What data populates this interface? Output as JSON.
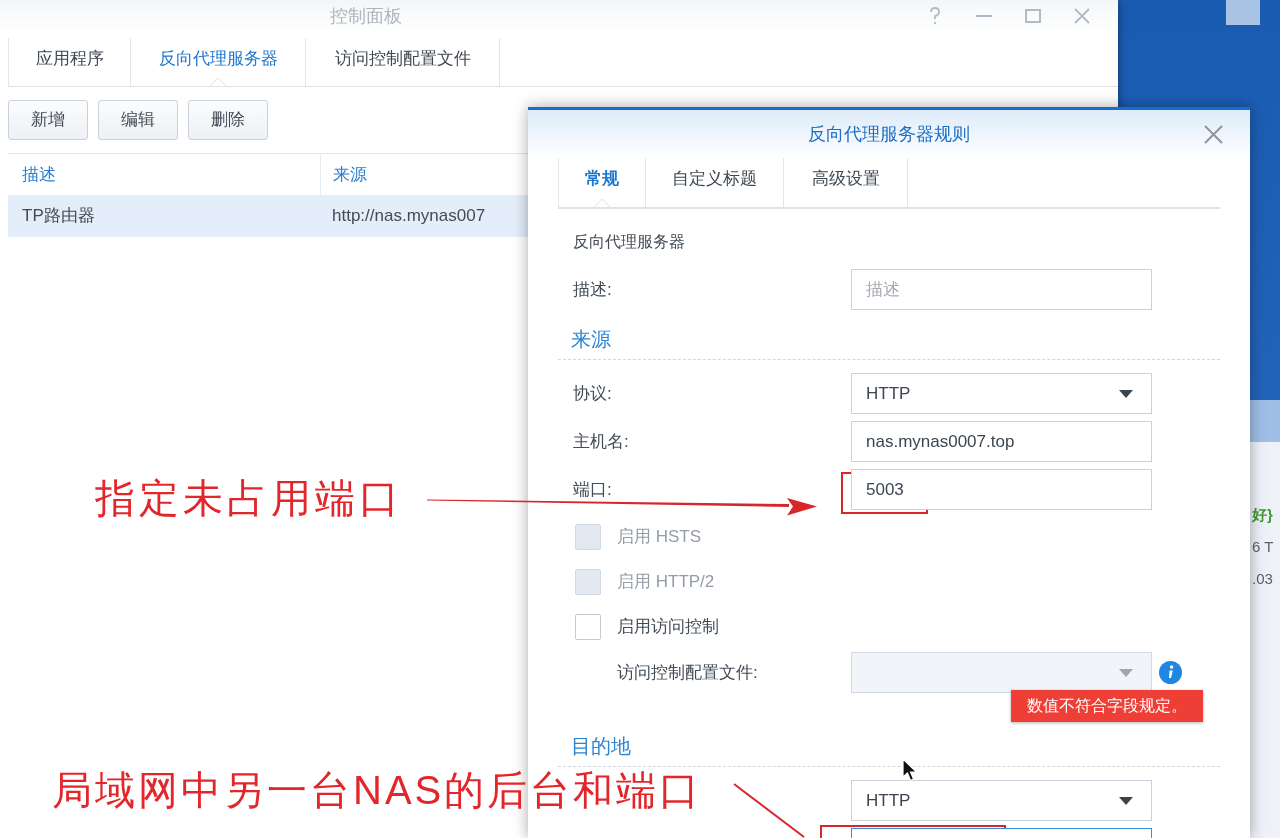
{
  "control_panel": {
    "title": "控制面板",
    "tabs": [
      {
        "label": "应用程序",
        "selected": false
      },
      {
        "label": "反向代理服务器",
        "selected": true
      },
      {
        "label": "访问控制配置文件",
        "selected": false
      }
    ],
    "toolbar": {
      "buttons": [
        "新增",
        "编辑",
        "删除"
      ]
    },
    "table": {
      "columns": [
        "描述",
        "来源"
      ],
      "rows": [
        {
          "cells": [
            "TP路由器",
            "http://nas.mynas007"
          ],
          "selected": true
        }
      ]
    }
  },
  "dialog": {
    "title": "反向代理服务器规则",
    "tabs": [
      {
        "label": "常规",
        "selected": true
      },
      {
        "label": "自定义标题",
        "selected": false
      },
      {
        "label": "高级设置",
        "selected": false
      }
    ],
    "rows": [
      {
        "kind": "caption",
        "text": "反向代理服务器"
      },
      {
        "kind": "text_field",
        "label": "描述:",
        "placeholder": "描述",
        "focused": false
      },
      {
        "kind": "section",
        "text": "来源"
      },
      {
        "kind": "select",
        "label": "协议:",
        "value": "HTTP",
        "disabled": false
      },
      {
        "kind": "text_field",
        "label": "主机名:",
        "value": "nas.mynas0007.top",
        "focused": false
      },
      {
        "kind": "text_field",
        "label": "端口:",
        "value": "5003",
        "focused": false
      },
      {
        "kind": "checkbox",
        "label": "启用 HSTS",
        "checked": false,
        "disabled": true
      },
      {
        "kind": "checkbox",
        "label": "启用 HTTP/2",
        "checked": false,
        "disabled": true
      },
      {
        "kind": "checkbox",
        "label": "启用访问控制",
        "checked": false,
        "disabled": false,
        "children": [
          {
            "kind": "select",
            "label": "访问控制配置文件:",
            "disabled": true,
            "info": true,
            "error": "数值不符合字段规定。"
          }
        ]
      },
      {
        "kind": "section",
        "text": "目的地"
      },
      {
        "kind": "select",
        "value": "HTTP",
        "disabled": false
      },
      {
        "kind": "text_field",
        "focused": true
      }
    ]
  },
  "desktop_widget": {
    "lines": [
      {
        "kind": "status",
        "text": "好}"
      },
      {
        "kind": "detail",
        "text": "6 T"
      },
      {
        "kind": "detail",
        "text": ".03"
      }
    ]
  },
  "annotations": [
    {
      "text": "指定未占用端口"
    },
    {
      "text": "局域网中另一台NAS的后台和端口"
    }
  ]
}
